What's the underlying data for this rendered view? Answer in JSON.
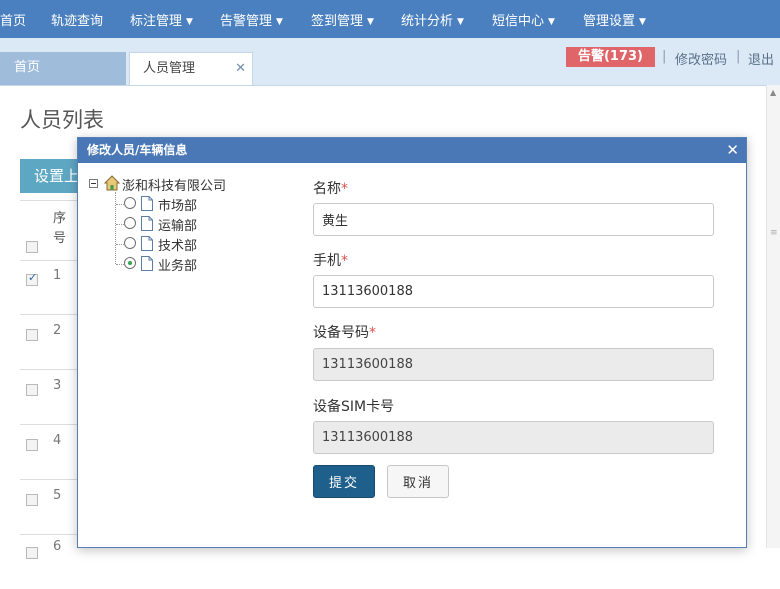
{
  "nav": {
    "items": [
      {
        "label": "首页",
        "dropdown": false
      },
      {
        "label": "轨迹查询",
        "dropdown": false
      },
      {
        "label": "标注管理",
        "dropdown": true
      },
      {
        "label": "告警管理",
        "dropdown": true
      },
      {
        "label": "签到管理",
        "dropdown": true
      },
      {
        "label": "统计分析",
        "dropdown": true
      },
      {
        "label": "短信中心",
        "dropdown": true
      },
      {
        "label": "管理设置",
        "dropdown": true
      }
    ]
  },
  "tabs": {
    "home": "首页",
    "active": "人员管理",
    "close_glyph": "✕"
  },
  "toolbar": {
    "alarm": "告警(173)",
    "separator": "|",
    "change_password": "修改密码",
    "logout": "退出"
  },
  "page": {
    "title": "人员列表",
    "set_button": "设置上",
    "table": {
      "header_seq": "序号",
      "rows": [
        {
          "num": "1",
          "checked": true
        },
        {
          "num": "2",
          "checked": false
        },
        {
          "num": "3",
          "checked": false
        },
        {
          "num": "4",
          "checked": false
        },
        {
          "num": "5",
          "checked": false
        },
        {
          "num": "6",
          "checked": false
        }
      ]
    }
  },
  "modal": {
    "title": "修改人员/车辆信息",
    "close_glyph": "✕",
    "tree": {
      "root": "澎和科技有限公司",
      "nodes": [
        {
          "label": "市场部",
          "selected": false
        },
        {
          "label": "运输部",
          "selected": false
        },
        {
          "label": "技术部",
          "selected": false
        },
        {
          "label": "业务部",
          "selected": true
        }
      ]
    },
    "form": {
      "name_label": "名称",
      "name_value": "黄生",
      "phone_label": "手机",
      "phone_value": "13113600188",
      "device_label": "设备号码",
      "device_value": "13113600188",
      "sim_label": "设备SIM卡号",
      "sim_value": "13113600188",
      "required_mark": "*",
      "submit": "提交",
      "cancel": "取消"
    }
  },
  "colors": {
    "nav_bg": "#4a80bf",
    "modal_header": "#4a78b6",
    "alarm_badge": "#e06569",
    "submit_button": "#1f5f8c"
  }
}
